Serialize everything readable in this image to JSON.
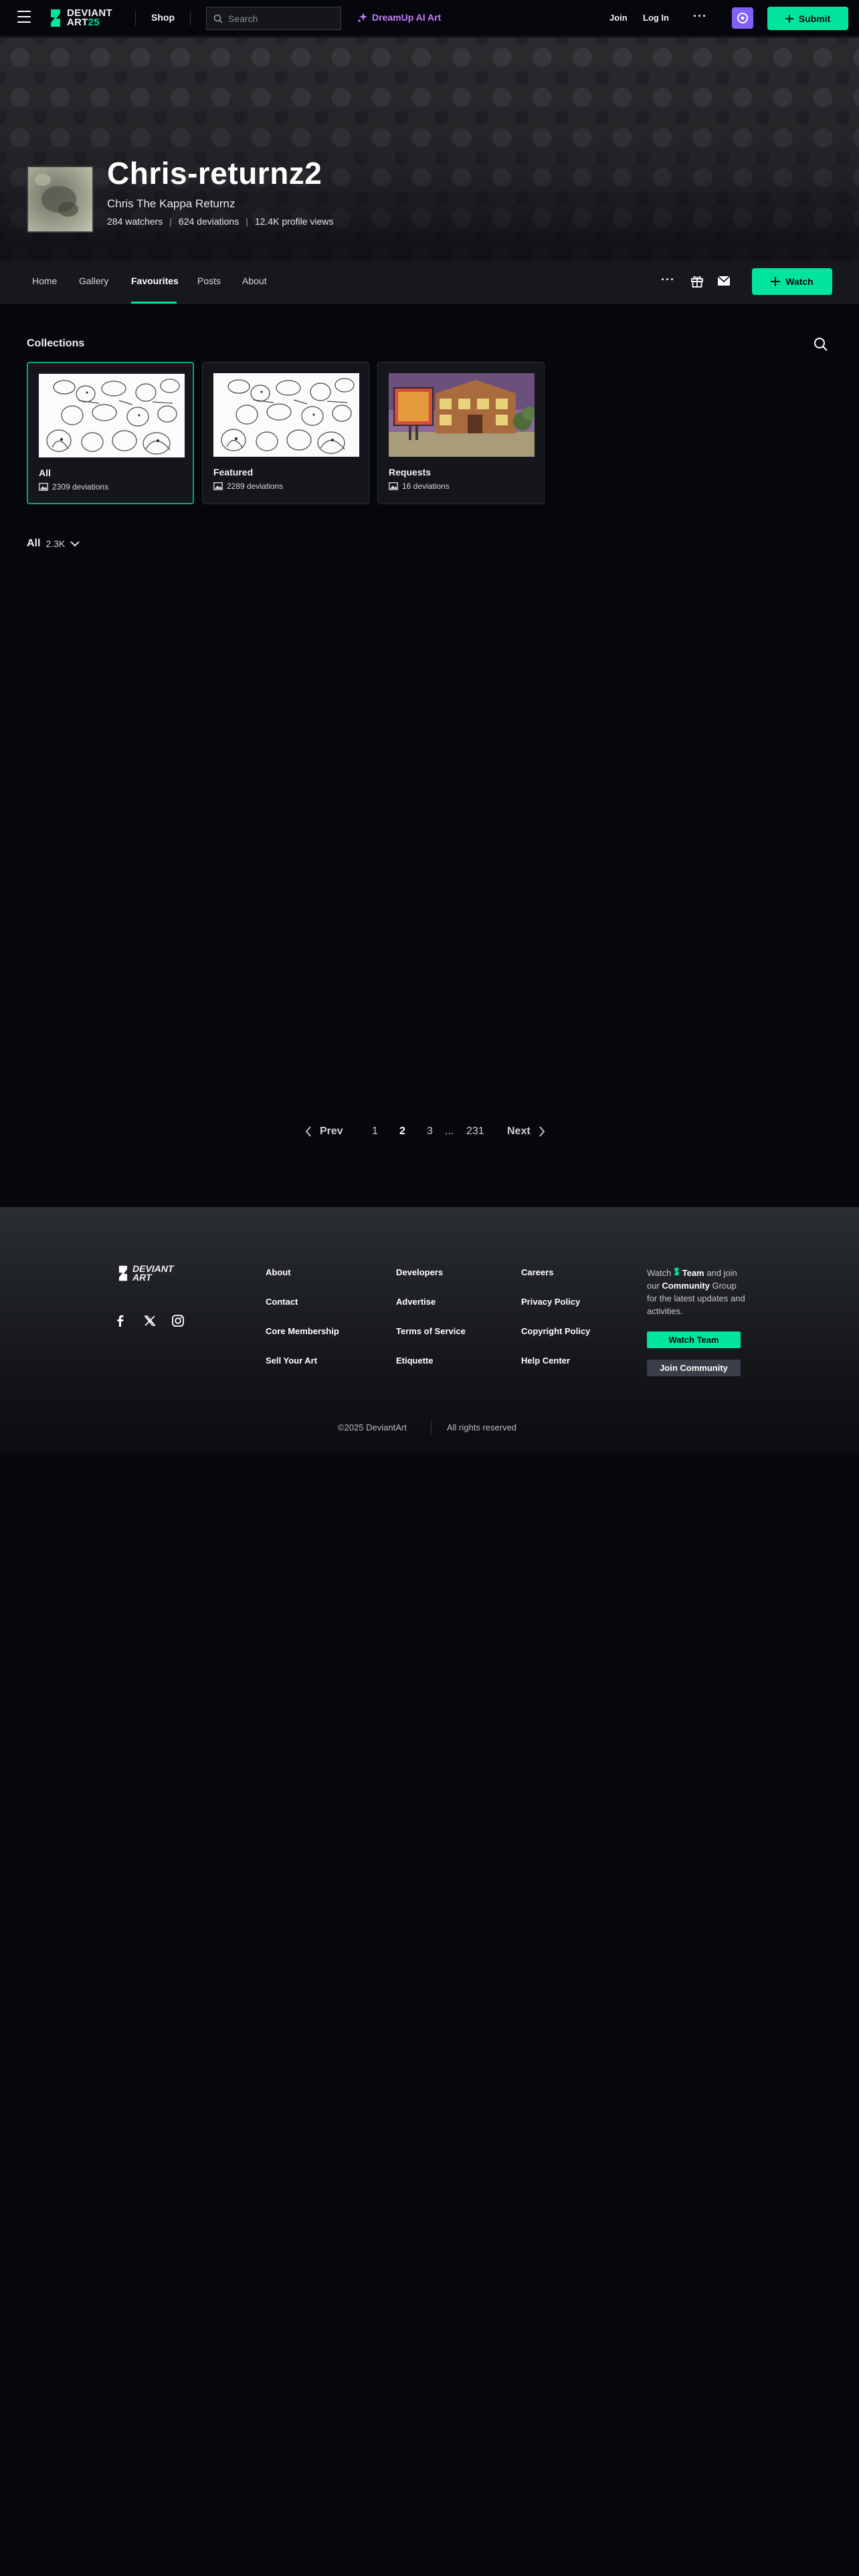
{
  "topbar": {
    "logo_line1": "DEVIANT",
    "logo_line2": "ART",
    "logo_year": "25",
    "shop": "Shop",
    "search_placeholder": "Search",
    "dreamup": "DreamUp AI Art",
    "join": "Join",
    "login": "Log In",
    "more": "···",
    "submit": "Submit"
  },
  "profile": {
    "name": "Chris-returnz2",
    "tagline": "Chris The Kappa Returnz",
    "watchers": "284 watchers",
    "deviations": "624 deviations",
    "views": "12.4K profile views",
    "stat_separator": "|"
  },
  "tabs": {
    "items": [
      {
        "label": "Home"
      },
      {
        "label": "Gallery"
      },
      {
        "label": "Favourites"
      },
      {
        "label": "Posts"
      },
      {
        "label": "About"
      }
    ],
    "active": "Favourites",
    "more": "···",
    "watch": "Watch"
  },
  "collections": {
    "title": "Collections",
    "cards": [
      {
        "name": "All",
        "count": "2309 deviations"
      },
      {
        "name": "Featured",
        "count": "2289 deviations"
      },
      {
        "name": "Requests",
        "count": "16 deviations"
      }
    ],
    "filter_label": "All",
    "filter_count": "2.3K"
  },
  "pagination": {
    "prev": "Prev",
    "pages": [
      "1",
      "2",
      "3"
    ],
    "current": "2",
    "ellipsis": "...",
    "last": "231",
    "next": "Next"
  },
  "footer": {
    "logo_line1": "DEVIANT",
    "logo_line2": "ART",
    "col1": [
      "About",
      "Contact",
      "Core Membership",
      "Sell Your Art"
    ],
    "col2": [
      "Developers",
      "Advertise",
      "Terms of Service",
      "Etiquette"
    ],
    "col3": [
      "Careers",
      "Privacy Policy",
      "Copyright Policy",
      "Help Center"
    ],
    "watch_prefix": "Watch",
    "watch_team": "Team",
    "watch_middle": "and join our",
    "watch_community": "Community",
    "watch_suffix": "Group for the latest updates and activities.",
    "watch_team_button": "Watch Team",
    "join_community_button": "Join Community",
    "copyright": "©2025 DeviantArt",
    "rights": "All rights reserved"
  },
  "colors": {
    "accent": "#00e59b",
    "background": "#06070d",
    "dreamup": "#c77dff",
    "core": "#8160f5"
  },
  "icons": [
    "menu-icon",
    "deviantart-logo-icon",
    "search-icon",
    "sparkle-icon",
    "core-badge-icon",
    "plus-icon",
    "gift-icon",
    "mail-icon",
    "image-icon",
    "chevron-down-icon",
    "chevron-left-icon",
    "chevron-right-icon",
    "facebook-icon",
    "x-icon",
    "instagram-icon"
  ]
}
